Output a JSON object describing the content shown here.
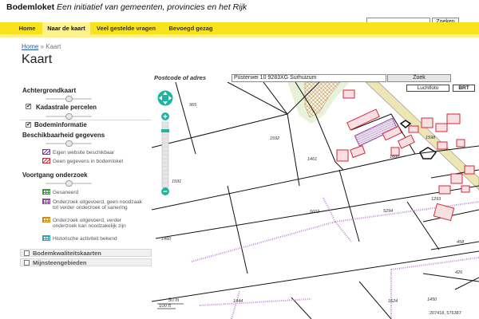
{
  "header": {
    "site_name": "Bodemloket",
    "tagline": "Een initiatief van gemeenten, provincies en het Rijk",
    "search_placeholder": "",
    "search_button": "Zoeken"
  },
  "nav": {
    "items": [
      {
        "label": "Home"
      },
      {
        "label": "Naar de kaart"
      },
      {
        "label": "Veel gestelde vragen"
      },
      {
        "label": "Bevoegd gezag"
      }
    ],
    "active_index": 1
  },
  "breadcrumb": {
    "home": "Home",
    "separator": "»",
    "current": "Kaart"
  },
  "page": {
    "title": "Kaart"
  },
  "sidebar": {
    "achtergrondkaart": {
      "title": "Achtergrondkaart"
    },
    "kadastrale": {
      "label": "Kadastrale percelen",
      "checked": true
    },
    "bodeminformatie": {
      "label": "Bodeminformatie",
      "checked": true
    },
    "beschikbaarheid": {
      "title": "Beschikbaarheid gegevens",
      "items": [
        {
          "label": "Eigen website beschikbaar",
          "color": "#6b3fa0"
        },
        {
          "label": "Geen gegevens in bodemloket",
          "color": "#d0303a"
        }
      ]
    },
    "voortgang": {
      "title": "Voortgang onderzoek",
      "items": [
        {
          "label": "Gesaneerd",
          "color": "#3a9a3a"
        },
        {
          "label": "Onderzoek uitgevoerd, geen noodzaak tot verder onderzoek of sanering",
          "color": "#8e44ad"
        },
        {
          "label": "Onderzoek uitgevoerd, verder onderzoek kan noodzakelijk zijn",
          "color": "#d08a1a"
        },
        {
          "label": "Historische activiteit bekend",
          "color": "#2aa8b8"
        }
      ]
    },
    "collapsed": [
      {
        "label": "Bodemkwaliteitskaarten"
      },
      {
        "label": "Mijnsteengebieden"
      }
    ]
  },
  "map": {
    "search_label": "Postcode of adres",
    "search_value": "Püsterwei 10 9283XG Surhuizum",
    "search_button": "Zoek",
    "toggles": [
      "Luchtfoto",
      "BRT"
    ],
    "parcel_numbers": [
      "965",
      "1592",
      "1461",
      "1591",
      "1600",
      "1598",
      "1293",
      "1460",
      "5602",
      "5294",
      "458",
      "426",
      "1444",
      "1450",
      "1624"
    ],
    "scale": {
      "meters": "50 m",
      "feet": "100 ft"
    },
    "coordinates": "207418, 576387"
  },
  "colors": {
    "brand": "#f7e21b",
    "nav_active": "#fff28e",
    "link": "#2a5aa8",
    "zoom": "#1eb4a0",
    "parcel_red": "#d22a3a",
    "road": "#ece6b4"
  }
}
